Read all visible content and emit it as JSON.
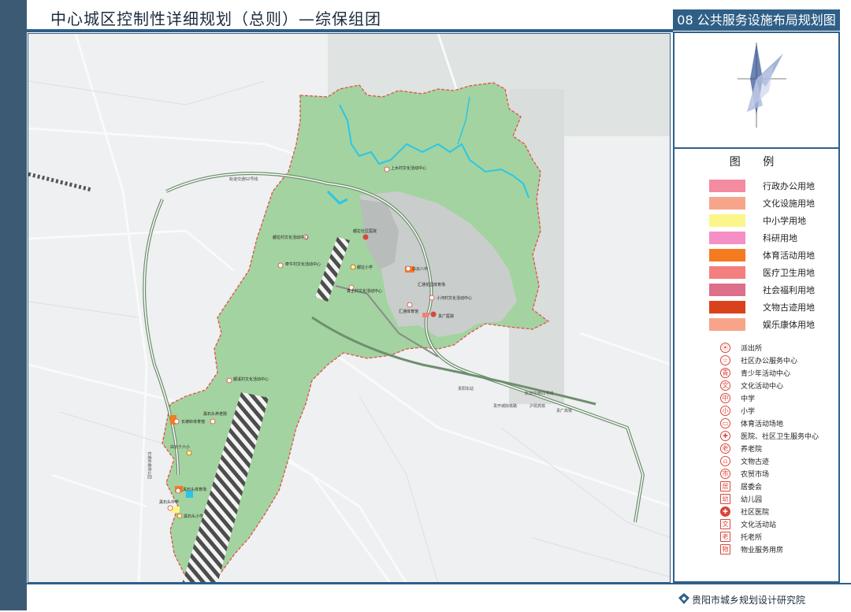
{
  "header": {
    "title": "中心城区控制性详细规划（总则）—综保组团",
    "sheet_title": "08 公共服务设施布局规划图"
  },
  "legend": {
    "title": "图 例",
    "land_uses": [
      {
        "label": "行政办公用地",
        "color": "#f48ba0"
      },
      {
        "label": "文化设施用地",
        "color": "#f7a58a"
      },
      {
        "label": "中小学用地",
        "color": "#fbf68a"
      },
      {
        "label": "科研用地",
        "color": "#f58fc6"
      },
      {
        "label": "体育活动用地",
        "color": "#f47b20"
      },
      {
        "label": "医疗卫生用地",
        "color": "#f47f7f"
      },
      {
        "label": "社会福利用地",
        "color": "#de6f8b"
      },
      {
        "label": "文物古迹用地",
        "color": "#d9421c"
      },
      {
        "label": "娱乐康体用地",
        "color": "#f8a488"
      }
    ],
    "symbols": [
      {
        "label": "派出所",
        "icon": "police-icon",
        "glyph": "⦿"
      },
      {
        "label": "社区办公服务中心",
        "icon": "community-office-icon",
        "glyph": "☆"
      },
      {
        "label": "青少年活动中心",
        "icon": "youth-center-icon",
        "glyph": "青"
      },
      {
        "label": "文化活动中心",
        "icon": "culture-center-icon",
        "glyph": "文"
      },
      {
        "label": "中学",
        "icon": "middle-school-icon",
        "glyph": "中"
      },
      {
        "label": "小学",
        "icon": "primary-school-icon",
        "glyph": "小"
      },
      {
        "label": "体育活动场地",
        "icon": "sports-field-icon",
        "glyph": "▭"
      },
      {
        "label": "医院、社区卫生服务中心",
        "icon": "hospital-icon",
        "glyph": "✚"
      },
      {
        "label": "养老院",
        "icon": "nursing-home-icon",
        "glyph": "老"
      },
      {
        "label": "文物古迹",
        "icon": "heritage-icon",
        "glyph": "⩍"
      },
      {
        "label": "农贸市场",
        "icon": "market-icon",
        "glyph": "市"
      },
      {
        "label": "居委会",
        "icon": "residents-committee-icon",
        "glyph": "居"
      },
      {
        "label": "幼儿园",
        "icon": "kindergarten-icon",
        "glyph": "幼"
      },
      {
        "label": "社区医院",
        "icon": "community-hospital-icon",
        "glyph": "✚"
      },
      {
        "label": "文化活动站",
        "icon": "culture-station-icon",
        "glyph": "文"
      },
      {
        "label": "托老所",
        "icon": "elderly-daycare-icon",
        "glyph": "老"
      },
      {
        "label": "物业服务用房",
        "icon": "property-service-icon",
        "glyph": "物"
      }
    ]
  },
  "map": {
    "rail_labels": [
      "轨道交通S2号线",
      "轨道交通S1号线",
      "贵阳东站",
      "贵开城际铁路",
      "沪昆高铁",
      "贵广高铁"
    ],
    "road_labels": [
      "长坡岭森林公园",
      "川",
      "白云大道"
    ],
    "poi_labels": [
      "上水村文化活动中心",
      "都拉村文化活动中心",
      "都拉社区医院",
      "牵牛村文化活动中心",
      "都拉小学",
      "白云八中",
      "汇通花园体育场",
      "真士村文化活动中心",
      "小河村文化活动中心",
      "汇通体育馆",
      "贵广医院",
      "都溪村文化活动中心",
      "黑石头养老院",
      "长坡岭体育馆",
      "白云十六小",
      "黑石头体育场",
      "黑石头中学",
      "黑石头小学"
    ]
  },
  "footer": {
    "institute": "贵阳市城乡规划设计研究院"
  }
}
